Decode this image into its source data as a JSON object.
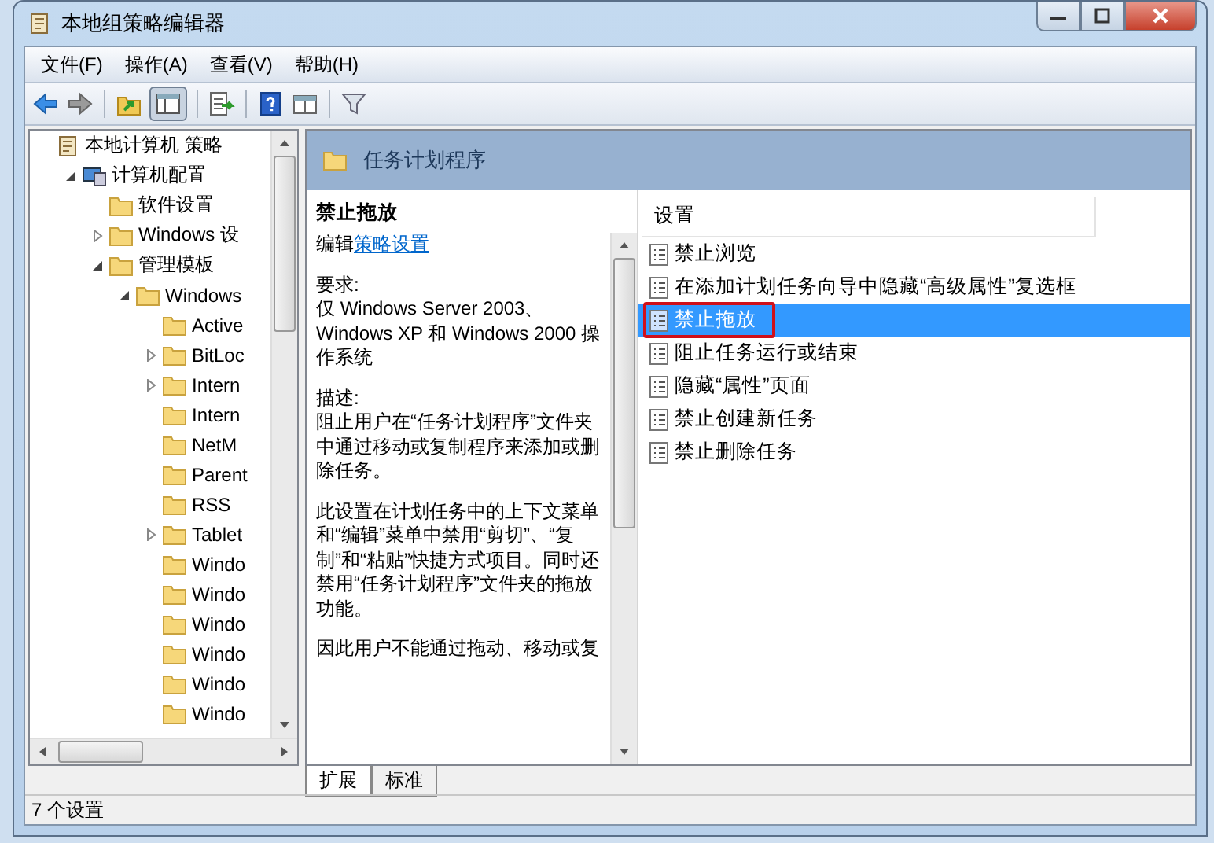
{
  "window": {
    "title": "本地组策略编辑器"
  },
  "menu": [
    {
      "label": "文件(F)"
    },
    {
      "label": "操作(A)"
    },
    {
      "label": "查看(V)"
    },
    {
      "label": "帮助(H)"
    }
  ],
  "toolbar": {
    "tree_toggle_pressed": true
  },
  "tree": [
    {
      "label": "本地计算机 策略",
      "kind": "policy",
      "expandable": false,
      "children": [
        {
          "label": "计算机配置",
          "kind": "computer",
          "expandable": true,
          "expanded": true,
          "children": [
            {
              "label": "软件设置",
              "kind": "folder",
              "expandable": false
            },
            {
              "label": "Windows 设",
              "kind": "folder",
              "expandable": true,
              "expanded": false
            },
            {
              "label": "管理模板",
              "kind": "folder",
              "expandable": true,
              "expanded": true,
              "children": [
                {
                  "label": "Windows",
                  "kind": "folder",
                  "expandable": true,
                  "expanded": true,
                  "children": [
                    {
                      "label": "Active",
                      "kind": "folder",
                      "expandable": false
                    },
                    {
                      "label": "BitLoc",
                      "kind": "folder",
                      "expandable": true,
                      "expanded": false
                    },
                    {
                      "label": "Intern",
                      "kind": "folder",
                      "expandable": true,
                      "expanded": false
                    },
                    {
                      "label": "Intern",
                      "kind": "folder",
                      "expandable": false
                    },
                    {
                      "label": "NetM",
                      "kind": "folder",
                      "expandable": false
                    },
                    {
                      "label": "Parent",
                      "kind": "folder",
                      "expandable": false
                    },
                    {
                      "label": "RSS",
                      "kind": "folder",
                      "expandable": false
                    },
                    {
                      "label": "Tablet",
                      "kind": "folder",
                      "expandable": true,
                      "expanded": false
                    },
                    {
                      "label": "Windo",
                      "kind": "folder",
                      "expandable": false
                    },
                    {
                      "label": "Windo",
                      "kind": "folder",
                      "expandable": false
                    },
                    {
                      "label": "Windo",
                      "kind": "folder",
                      "expandable": false
                    },
                    {
                      "label": "Windo",
                      "kind": "folder",
                      "expandable": false
                    },
                    {
                      "label": "Windo",
                      "kind": "folder",
                      "expandable": false
                    },
                    {
                      "label": "Windo",
                      "kind": "folder",
                      "expandable": false
                    }
                  ]
                }
              ]
            }
          ]
        }
      ]
    }
  ],
  "header": {
    "title": "任务计划程序"
  },
  "description": {
    "title": "禁止拖放",
    "edit_prefix": "编辑",
    "edit_link": "策略设置",
    "sections": [
      {
        "heading": "要求:",
        "text": "仅 Windows Server 2003、Windows XP 和 Windows 2000 操作系统"
      },
      {
        "heading": "描述:",
        "text": "阻止用户在“任务计划程序”文件夹中通过移动或复制程序来添加或删除任务。"
      }
    ],
    "paragraphs": [
      "此设置在计划任务中的上下文菜单和“编辑”菜单中禁用“剪切”、“复制”和“粘贴”快捷方式项目。同时还禁用“任务计划程序”文件夹的拖放功能。",
      "因此用户不能通过拖动、移动或复"
    ]
  },
  "settings": {
    "column": "设置",
    "rows": [
      {
        "label": "禁止浏览",
        "selected": false,
        "marked": false
      },
      {
        "label": "在添加计划任务向导中隐藏“高级属性”复选框",
        "selected": false,
        "marked": false
      },
      {
        "label": "禁止拖放",
        "selected": true,
        "marked": true
      },
      {
        "label": "阻止任务运行或结束",
        "selected": false,
        "marked": false
      },
      {
        "label": "隐藏“属性”页面",
        "selected": false,
        "marked": false
      },
      {
        "label": "禁止创建新任务",
        "selected": false,
        "marked": false
      },
      {
        "label": "禁止删除任务",
        "selected": false,
        "marked": false
      }
    ]
  },
  "tabs": [
    {
      "label": "扩展",
      "selected": true
    },
    {
      "label": "标准",
      "selected": false
    }
  ],
  "status_bar": {
    "text": "7 个设置"
  }
}
